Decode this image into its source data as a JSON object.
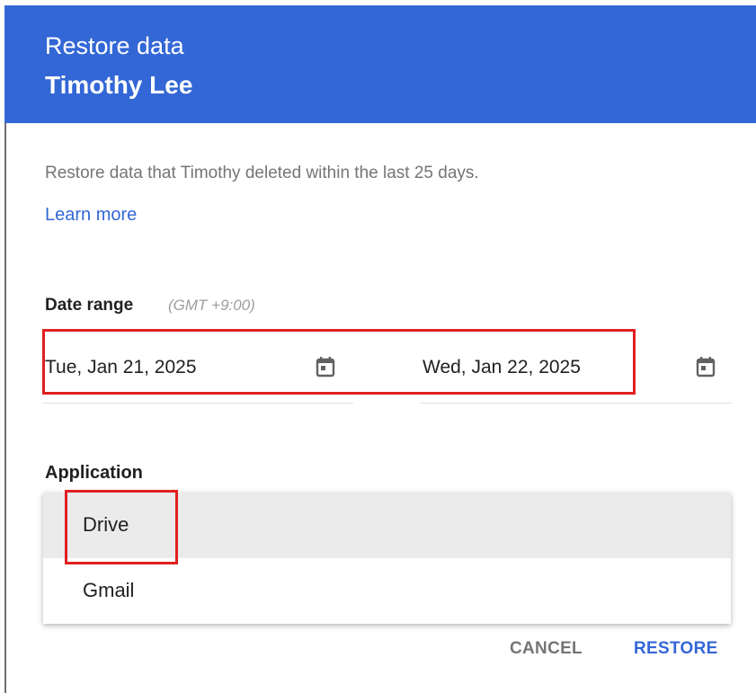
{
  "header": {
    "title": "Restore data",
    "user_name": "Timothy Lee"
  },
  "description": "Restore data that Timothy deleted within the last 25 days.",
  "learn_more": "Learn more",
  "date_range": {
    "label": "Date range",
    "timezone": "(GMT +9:00)",
    "start_date": "Tue, Jan 21, 2025",
    "end_date": "Wed, Jan 22, 2025"
  },
  "application": {
    "label": "Application",
    "options": [
      {
        "label": "Drive",
        "highlighted": true
      },
      {
        "label": "Gmail",
        "highlighted": false
      }
    ]
  },
  "actions": {
    "cancel": "CANCEL",
    "restore": "RESTORE"
  },
  "colors": {
    "header_bg": "#3367d6",
    "link": "#3367d6",
    "annotation_highlight": "#e02020"
  },
  "icons": {
    "start_date": "calendar-icon",
    "end_date": "calendar-icon"
  }
}
